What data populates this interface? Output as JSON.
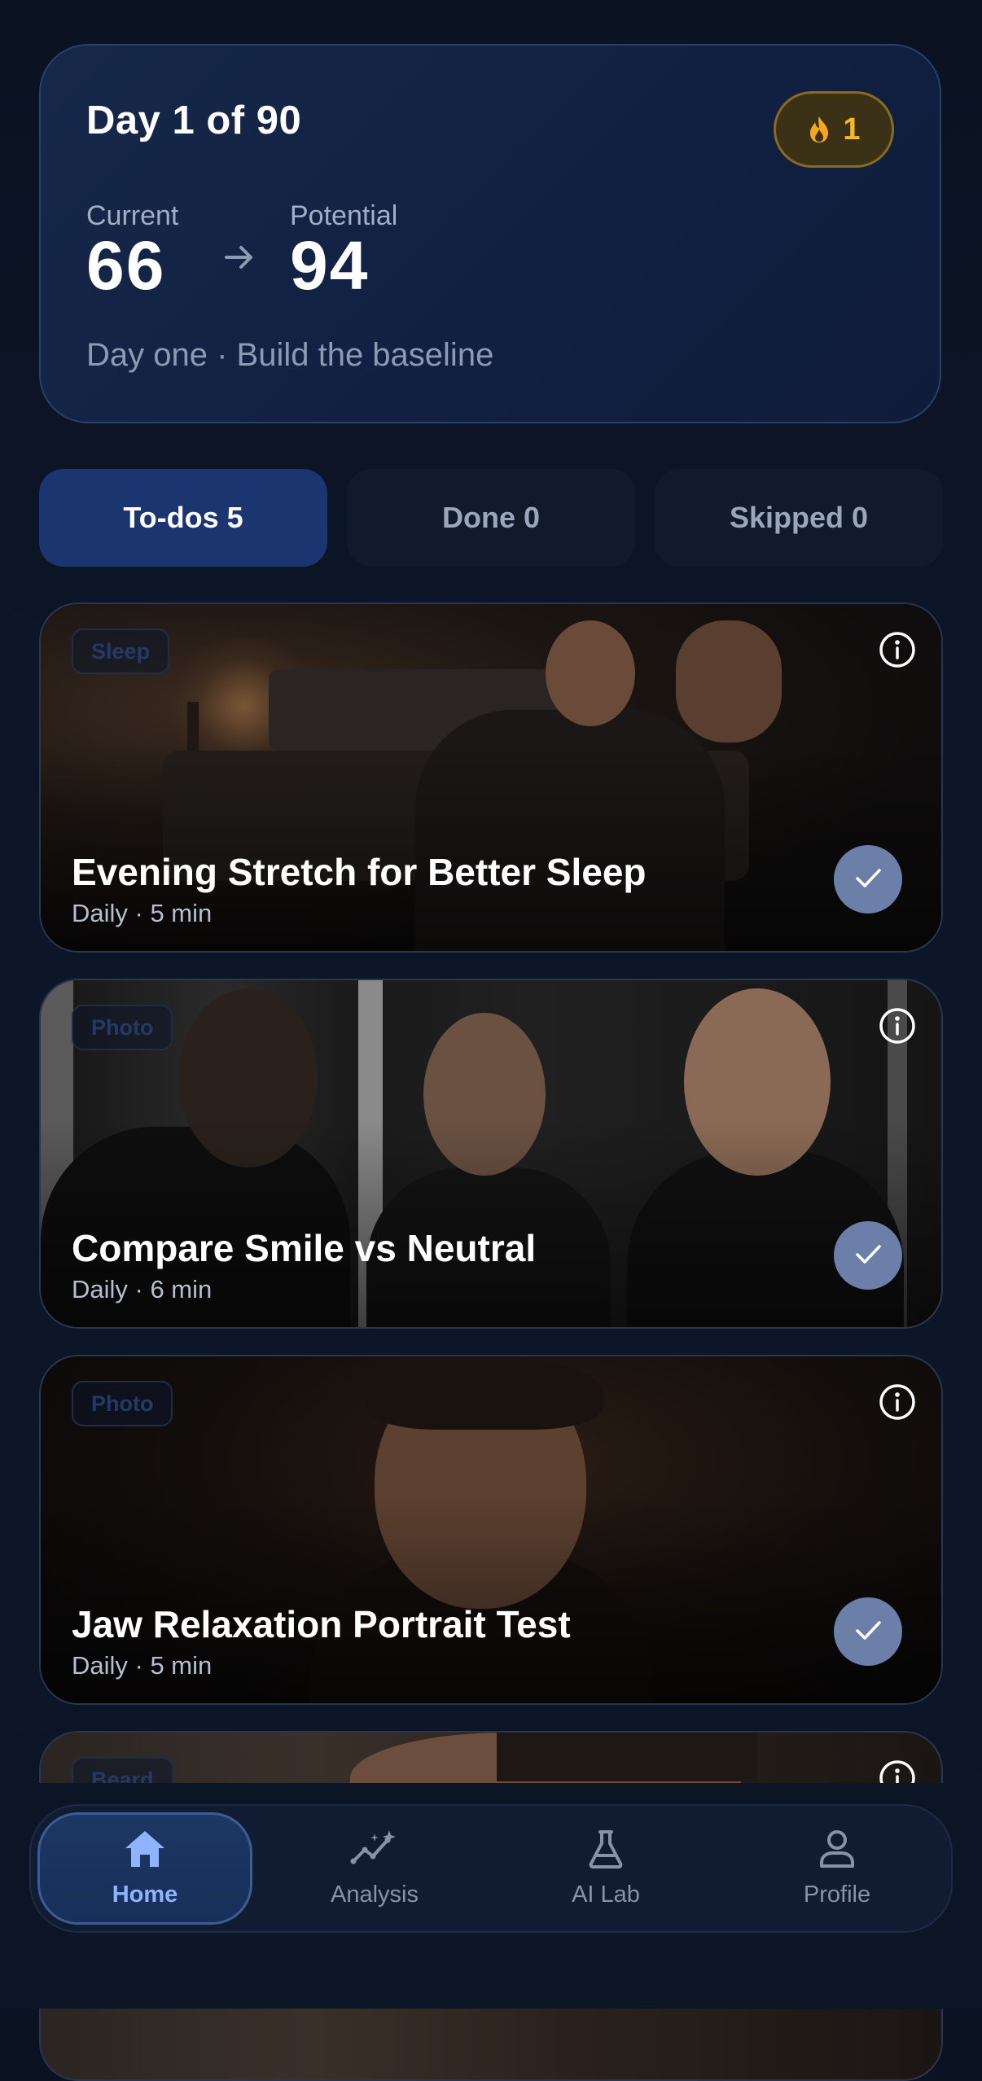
{
  "header": {
    "day_title": "Day 1 of 90",
    "streak_count": "1",
    "current_label": "Current",
    "current_score": "66",
    "potential_label": "Potential",
    "potential_score": "94",
    "subtitle": "Day one · Build the baseline"
  },
  "tabs": [
    {
      "label": "To-dos 5",
      "active": true
    },
    {
      "label": "Done 0",
      "active": false
    },
    {
      "label": "Skipped 0",
      "active": false
    }
  ],
  "tasks": [
    {
      "category": "Sleep",
      "title": "Evening Stretch for Better Sleep",
      "meta": "Daily · 5 min"
    },
    {
      "category": "Photo",
      "title": "Compare Smile vs Neutral",
      "meta": "Daily · 6 min"
    },
    {
      "category": "Photo",
      "title": "Jaw Relaxation Portrait Test",
      "meta": "Daily · 5 min"
    },
    {
      "category": "Beard",
      "title": "",
      "meta": ""
    }
  ],
  "nav": [
    {
      "label": "Home",
      "icon": "home-icon",
      "active": true
    },
    {
      "label": "Analysis",
      "icon": "analysis-icon",
      "active": false
    },
    {
      "label": "AI Lab",
      "icon": "flask-icon",
      "active": false
    },
    {
      "label": "Profile",
      "icon": "profile-icon",
      "active": false
    }
  ],
  "colors": {
    "background": "#0c1526",
    "accent": "#1a3570",
    "streak": "#f5b828",
    "nav_active": "#8fb3ff"
  }
}
